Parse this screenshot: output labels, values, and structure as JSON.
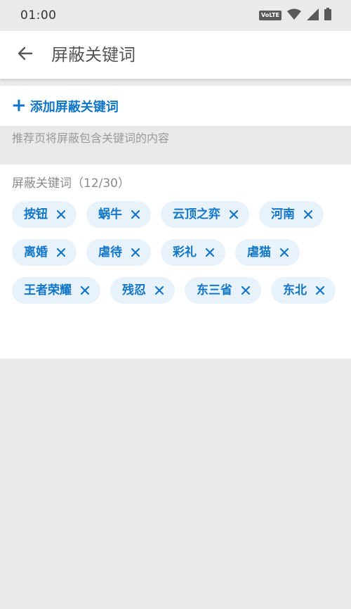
{
  "status_bar": {
    "time": "01:00",
    "volte_label": "VoLTE"
  },
  "header": {
    "back_icon": "arrow-left-icon",
    "title": "屏蔽关键词"
  },
  "add_keyword": {
    "icon": "plus-icon",
    "plus_glyph": "+",
    "label": "添加屏蔽关键词"
  },
  "hint": "推荐页将屏蔽包含关键词的内容",
  "keywords": {
    "header": "屏蔽关键词（12/30）",
    "remove_icon": "close-icon",
    "rows": [
      [
        "按钮",
        "蜗牛",
        "云顶之弈",
        "河南"
      ],
      [
        "离婚",
        "虐待",
        "彩礼",
        "虐猫"
      ],
      [
        "王者荣耀",
        "残忍",
        "东三省",
        "东北"
      ]
    ]
  },
  "colors": {
    "accent": "#1276c8",
    "chip_bg": "#e7f2fb",
    "page_bg": "#e9e9e9",
    "status_bar_bg": "#e9eaec",
    "hint_text": "#9a9a9a"
  }
}
